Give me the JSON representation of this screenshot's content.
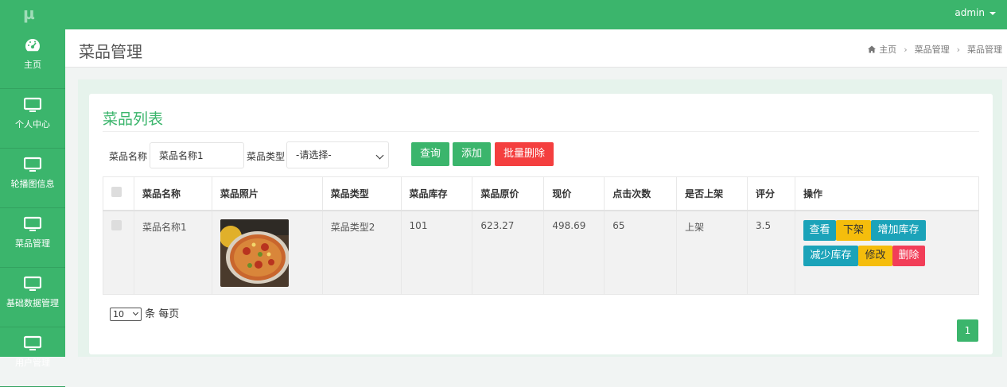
{
  "topbar": {
    "logo": "µ",
    "user": "admin"
  },
  "sidebar": {
    "items": [
      {
        "label": "主页",
        "icon": "dashboard-icon"
      },
      {
        "label": "个人中心",
        "icon": "monitor-icon"
      },
      {
        "label": "轮播图信息",
        "icon": "monitor-icon"
      },
      {
        "label": "菜品管理",
        "icon": "monitor-icon"
      },
      {
        "label": "基础数据管理",
        "icon": "monitor-icon"
      },
      {
        "label": "用户管理",
        "icon": "monitor-icon"
      }
    ]
  },
  "header": {
    "title": "菜品管理",
    "breadcrumb": [
      "主页",
      "菜品管理",
      "菜品管理"
    ]
  },
  "panel": {
    "title": "菜品列表",
    "filters": {
      "name_label": "菜品名称",
      "name_value": "菜品名称1",
      "type_label": "菜品类型",
      "type_value": "-请选择-"
    },
    "buttons": {
      "search": "查询",
      "add": "添加",
      "batch_delete": "批量删除"
    }
  },
  "table": {
    "headers": [
      "菜品名称",
      "菜品照片",
      "菜品类型",
      "菜品库存",
      "菜品原价",
      "现价",
      "点击次数",
      "是否上架",
      "评分",
      "操作"
    ],
    "rows": [
      {
        "name": "菜品名称1",
        "type": "菜品类型2",
        "stock": "101",
        "original_price": "623.27",
        "price": "498.69",
        "clicks": "65",
        "on_shelf": "上架",
        "rating": "3.5",
        "actions": {
          "view": "查看",
          "off_shelf": "下架",
          "add_stock": "增加库存",
          "reduce_stock": "减少库存",
          "edit": "修改",
          "delete": "删除"
        }
      }
    ]
  },
  "pagination": {
    "page_size": "10",
    "page_size_suffix": "条 每页",
    "current_page": "1"
  },
  "colors": {
    "brand": "#3bb56c",
    "danger": "#f43f3f",
    "info": "#1ba3b9",
    "warning": "#f5bd0c"
  }
}
